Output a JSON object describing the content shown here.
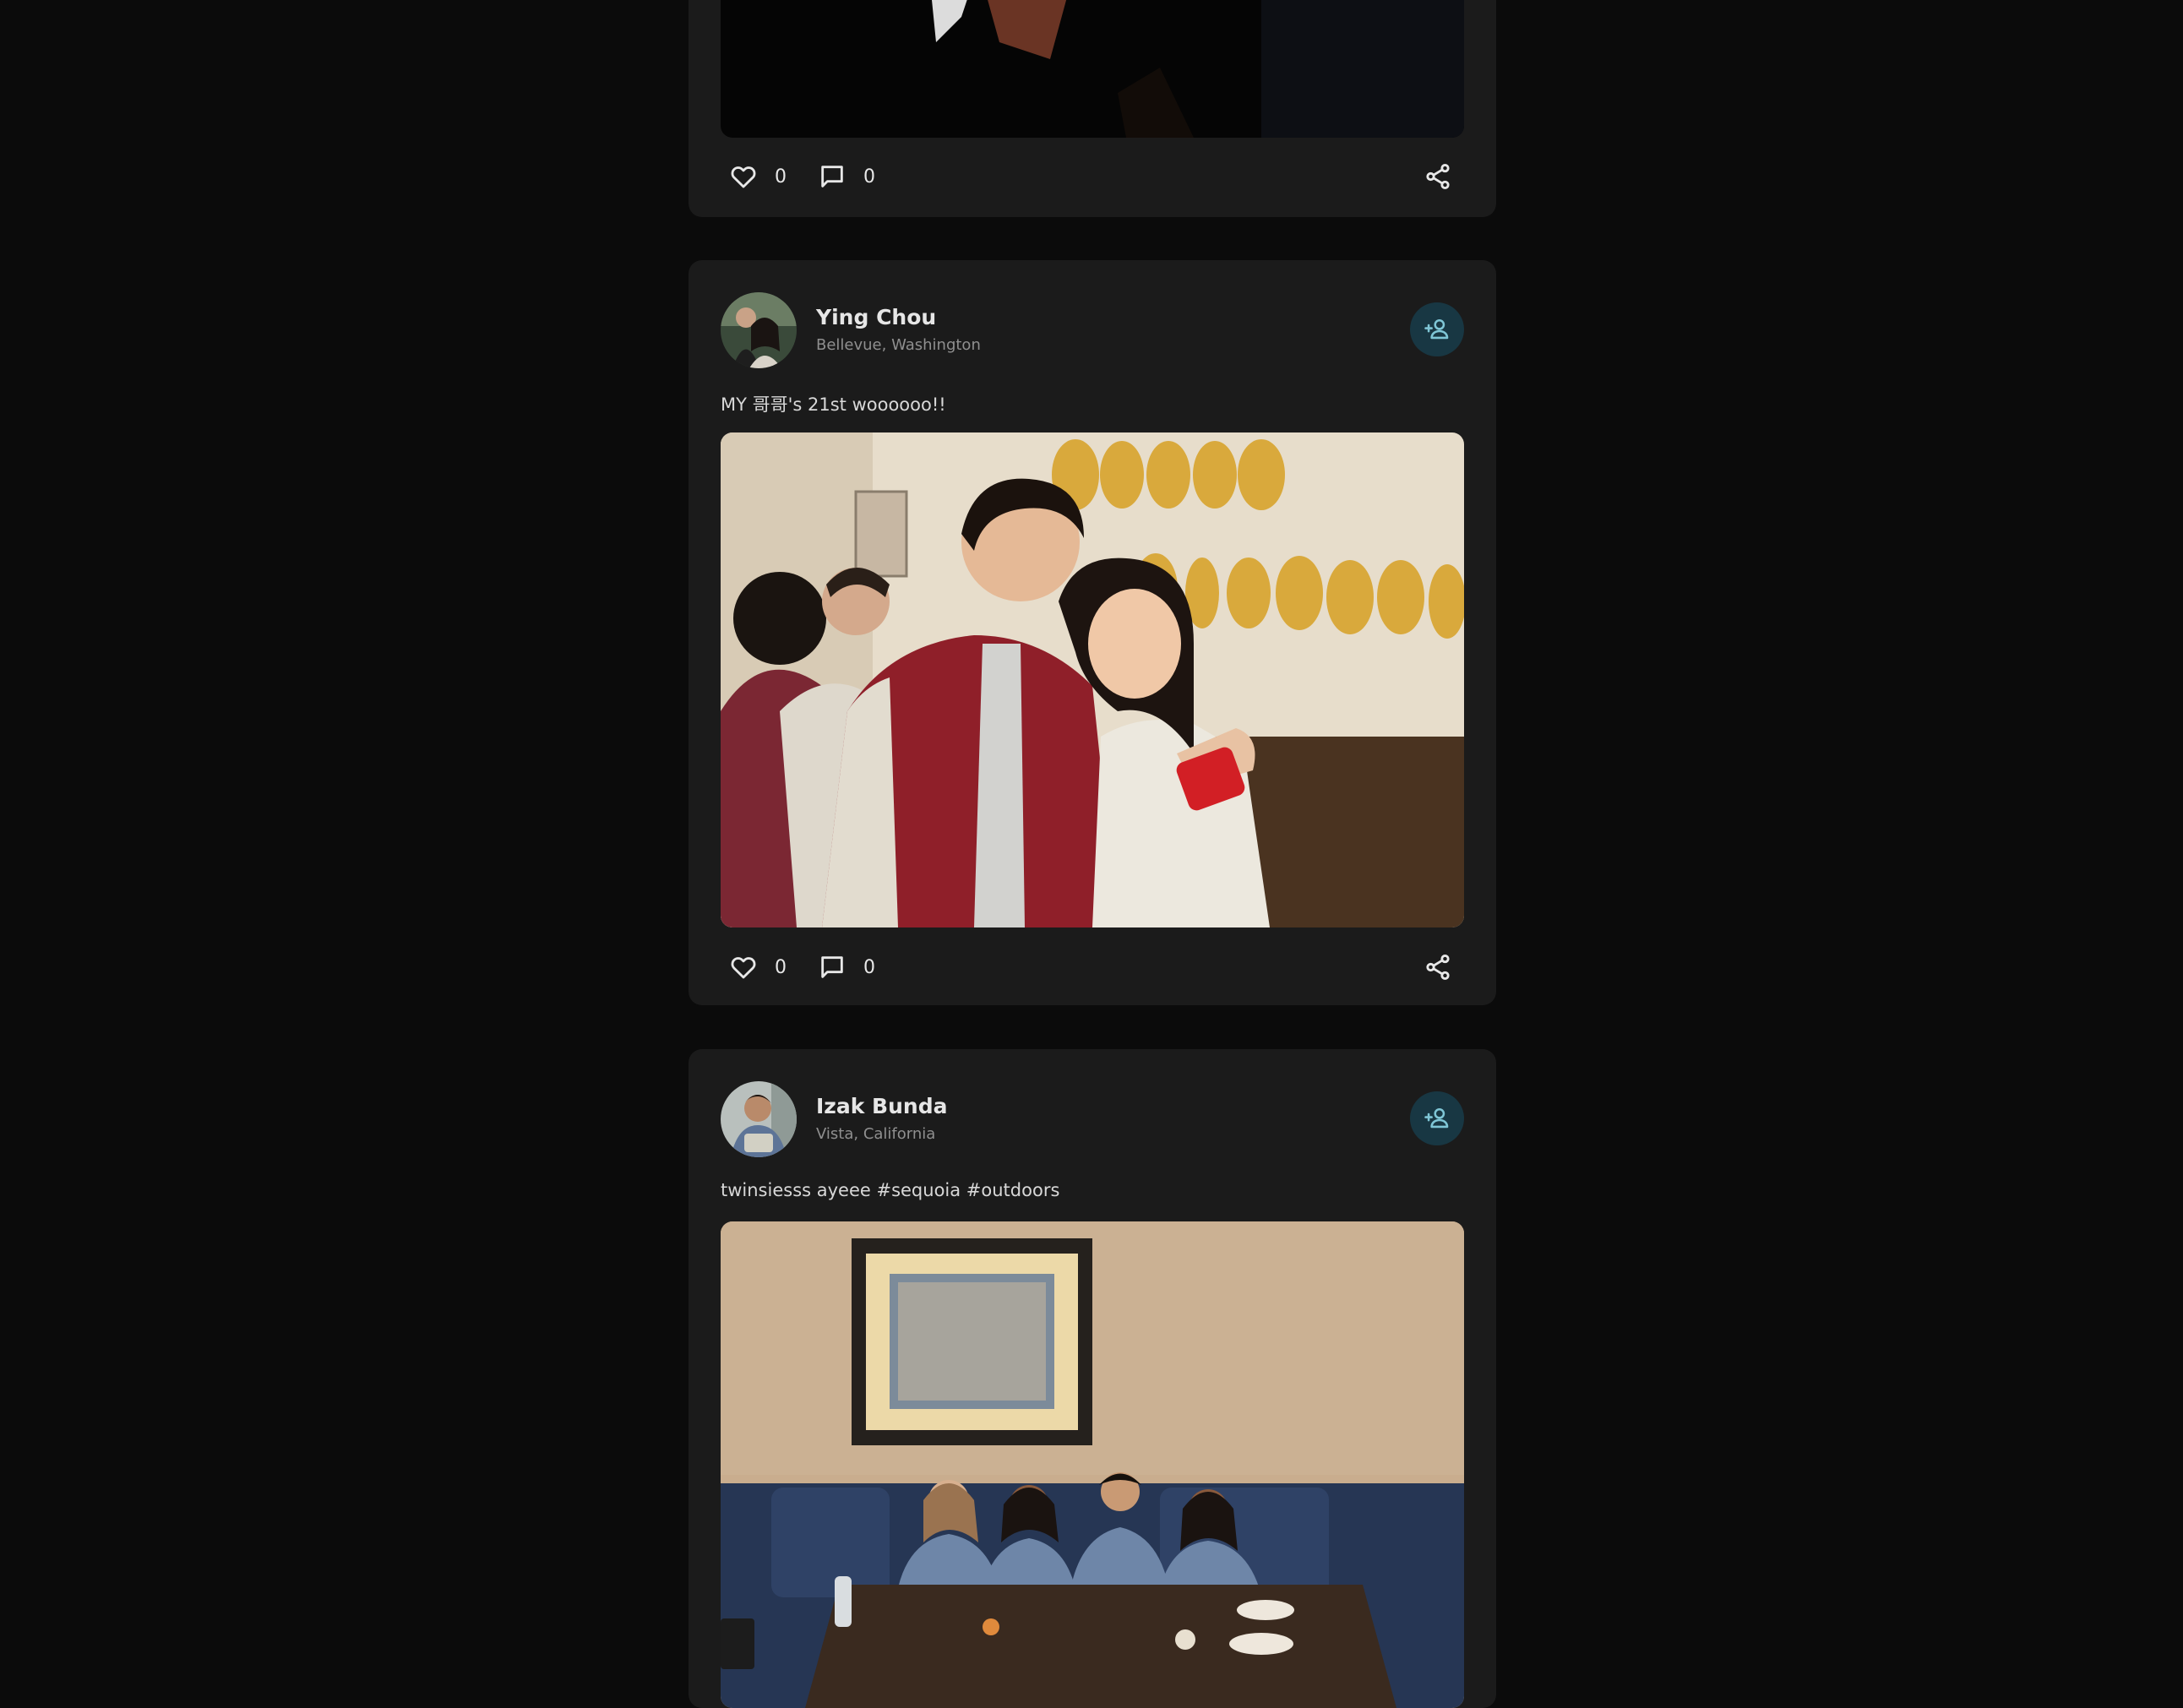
{
  "colors": {
    "page_background": "#0b0b0b",
    "card_background": "#1b1b1b",
    "follow_button_background": "#183743",
    "follow_icon": "#7fc6d6"
  },
  "posts": [
    {
      "photo_description": "dark photo, partially scrolled out of view",
      "likes": "0",
      "comments": "0",
      "icons": [
        "heart-icon",
        "comment-icon",
        "share-icon"
      ]
    },
    {
      "author": "Ying Chou",
      "location": "Bellevue, Washington",
      "caption": "MY 哥哥's 21st woooooo!!",
      "likes": "0",
      "comments": "0",
      "icons": [
        "user-plus-icon",
        "heart-icon",
        "comment-icon",
        "share-icon"
      ]
    },
    {
      "author": "Izak Bunda",
      "location": "Vista, California",
      "caption": "twinsiesss ayeee #sequoia #outdoors",
      "icons": [
        "user-plus-icon"
      ]
    }
  ]
}
